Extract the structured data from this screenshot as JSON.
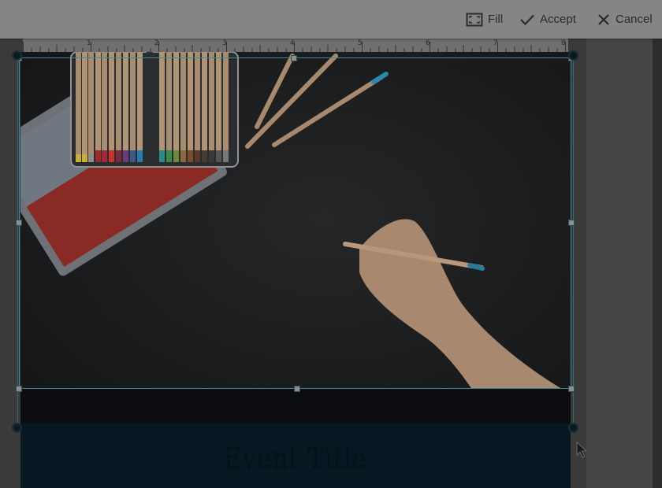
{
  "toolbar": {
    "fill_label": "Fill",
    "accept_label": "Accept",
    "cancel_label": "Cancel"
  },
  "ruler": {
    "marks": [
      "1",
      "2",
      "3",
      "4",
      "5",
      "6",
      "7",
      "8"
    ]
  },
  "document": {
    "title": "Event Title"
  },
  "colors": {
    "toolbar_bg": "#858585",
    "crop_border": "#3b8c99",
    "title_band": "#061822"
  }
}
